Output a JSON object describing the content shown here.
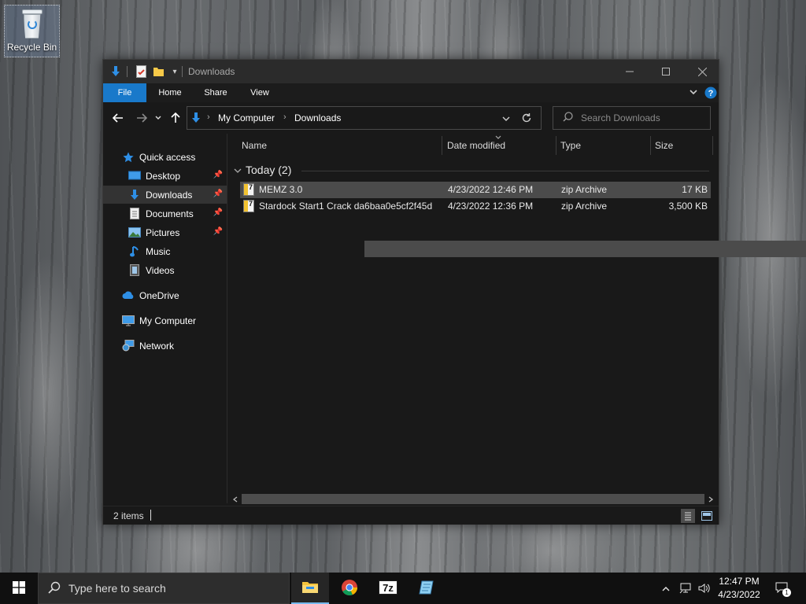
{
  "desktop": {
    "recycle_bin_label": "Recycle Bin"
  },
  "window": {
    "title": "Downloads",
    "ribbon_tabs": [
      "File",
      "Home",
      "Share",
      "View"
    ],
    "address": {
      "segments": [
        "My Computer",
        "Downloads"
      ]
    },
    "search_placeholder": "Search Downloads",
    "sidebar": {
      "items": [
        {
          "label": "Quick access",
          "icon": "star-icon"
        },
        {
          "label": "Desktop",
          "icon": "desktop-icon",
          "pinned": true
        },
        {
          "label": "Downloads",
          "icon": "download-arrow-icon",
          "pinned": true,
          "selected": true
        },
        {
          "label": "Documents",
          "icon": "document-icon",
          "pinned": true
        },
        {
          "label": "Pictures",
          "icon": "picture-icon",
          "pinned": true
        },
        {
          "label": "Music",
          "icon": "music-note-icon"
        },
        {
          "label": "Videos",
          "icon": "film-icon"
        },
        {
          "label": "OneDrive",
          "icon": "cloud-icon"
        },
        {
          "label": "My Computer",
          "icon": "monitor-icon"
        },
        {
          "label": "Network",
          "icon": "network-icon"
        }
      ]
    },
    "columns": [
      "Name",
      "Date modified",
      "Type",
      "Size"
    ],
    "group_label": "Today (2)",
    "files": [
      {
        "name": "MEMZ 3.0",
        "date": "4/23/2022 12:46 PM",
        "type": "zip Archive",
        "size": "17 KB",
        "selected": true
      },
      {
        "name": "Stardock Start1 Crack da6baa0e5cf2f45d",
        "date": "4/23/2022 12:36 PM",
        "type": "zip Archive",
        "size": "3,500 KB",
        "selected": false
      }
    ],
    "status": "2 items"
  },
  "taskbar": {
    "search_placeholder": "Type here to search",
    "apps": [
      "file-explorer-icon",
      "chrome-icon",
      "7zip-icon",
      "notepad-icon"
    ],
    "time": "12:47 PM",
    "date": "4/23/2022",
    "notification_count": "1"
  },
  "colors": {
    "accent": "#1979ca",
    "window_bg": "#191919",
    "titlebar_bg": "#2b2b2b",
    "selected_row": "#4b4b4b"
  }
}
